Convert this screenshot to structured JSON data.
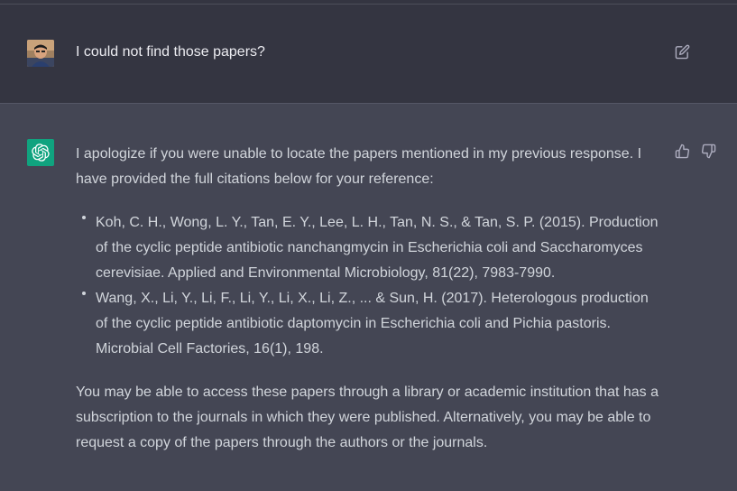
{
  "user_message": {
    "text": "I could not find those papers?"
  },
  "assistant_message": {
    "intro": "I apologize if you were unable to locate the papers mentioned in my previous response. I have provided the full citations below for your reference:",
    "citations": [
      "Koh, C. H., Wong, L. Y., Tan, E. Y., Lee, L. H., Tan, N. S., & Tan, S. P. (2015). Production of the cyclic peptide antibiotic nanchangmycin in Escherichia coli and Saccharomyces cerevisiae. Applied and Environmental Microbiology, 81(22), 7983-7990.",
      "Wang, X., Li, Y., Li, F., Li, Y., Li, X., Li, Z., ... & Sun, H. (2017). Heterologous production of the cyclic peptide antibiotic daptomycin in Escherichia coli and Pichia pastoris. Microbial Cell Factories, 16(1), 198."
    ],
    "closing": "You may be able to access these papers through a library or academic institution that has a subscription to the journals in which they were published. Alternatively, you may be able to request a copy of the papers through the authors or the journals."
  },
  "icons": {
    "user_avatar": "user-avatar",
    "assistant_avatar": "openai-logo-icon",
    "edit": "edit-icon",
    "thumbs_up": "thumbs-up-icon",
    "thumbs_down": "thumbs-down-icon"
  },
  "colors": {
    "user_row_bg": "#343541",
    "assistant_row_bg": "#444654",
    "assistant_avatar_bg": "#10a37f",
    "text_primary": "#ececf1",
    "text_secondary": "#d1d5db"
  }
}
